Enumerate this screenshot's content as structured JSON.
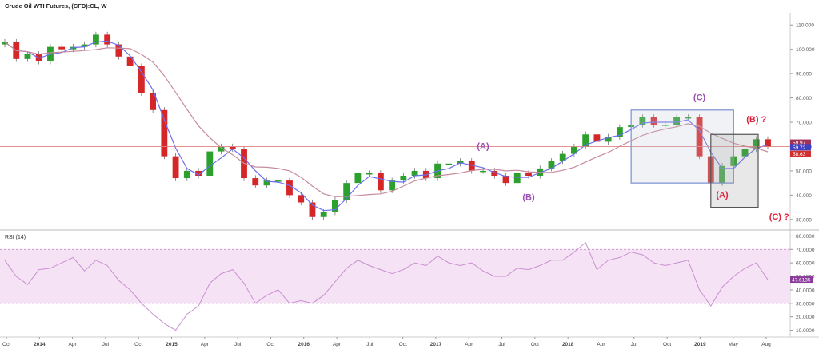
{
  "header": {
    "title": "Crude Oil WTI Futures, (CFD):CL, W"
  },
  "colors": {
    "up": "#2ca02c",
    "down": "#d62728",
    "ma_fast": "#6b6ef0",
    "ma_slow": "#c78b9c",
    "rsi_line": "#c98fd0",
    "rsi_band": "#f5e3f5",
    "price_line": "#e08080",
    "box_blue": "#7a8fd0",
    "box_dark": "#555555",
    "label_purple": "#9b4fb0",
    "label_red": "#e0203a"
  },
  "chart_data": [
    {
      "type": "candlestick",
      "title": "Crude Oil WTI Futures, (CFD):CL, W",
      "x": [
        "2013-10",
        "2013-11",
        "2013-12",
        "2014-01",
        "2014-02",
        "2014-03",
        "2014-04",
        "2014-05",
        "2014-06",
        "2014-07",
        "2014-08",
        "2014-09",
        "2014-10",
        "2014-11",
        "2014-12",
        "2015-01",
        "2015-02",
        "2015-03",
        "2015-04",
        "2015-05",
        "2015-06",
        "2015-07",
        "2015-08",
        "2015-09",
        "2015-10",
        "2015-11",
        "2015-12",
        "2016-01",
        "2016-02",
        "2016-03",
        "2016-04",
        "2016-05",
        "2016-06",
        "2016-07",
        "2016-08",
        "2016-09",
        "2016-10",
        "2016-11",
        "2016-12",
        "2017-01",
        "2017-02",
        "2017-03",
        "2017-04",
        "2017-05",
        "2017-06",
        "2017-07",
        "2017-08",
        "2017-09",
        "2017-10",
        "2017-11",
        "2017-12",
        "2018-01",
        "2018-02",
        "2018-03",
        "2018-04",
        "2018-05",
        "2018-06",
        "2018-07",
        "2018-08",
        "2018-09",
        "2018-10",
        "2018-11",
        "2018-12",
        "2019-01",
        "2019-02",
        "2019-03",
        "2019-04",
        "2019-05"
      ],
      "close": [
        103,
        96,
        98,
        95,
        101,
        100,
        101,
        102,
        106,
        102,
        97,
        93,
        82,
        75,
        56,
        47,
        50,
        48,
        58,
        60,
        59,
        47,
        44,
        46,
        46,
        40,
        37,
        31,
        33,
        38,
        45,
        49,
        49,
        42,
        46,
        48,
        50,
        47,
        53,
        53,
        54,
        50,
        50,
        48,
        45,
        49,
        48,
        51,
        54,
        57,
        60,
        65,
        62,
        64,
        68,
        69,
        72,
        69,
        69,
        72,
        72,
        56,
        45,
        52,
        56,
        59,
        63,
        59.97
      ],
      "ylim": [
        26,
        115
      ],
      "y_ticks": [
        "110.000",
        "100.000",
        "90.000",
        "80.000",
        "70.000",
        "60.000",
        "50.000",
        "40.000",
        "30.000"
      ],
      "x_tick_labels": [
        "Oct",
        "2014",
        "Apr",
        "Jul",
        "Oct",
        "2015",
        "Apr",
        "Jul",
        "Oct",
        "2016",
        "Apr",
        "Jul",
        "Oct",
        "2017",
        "Apr",
        "Jul",
        "Oct",
        "2018",
        "Apr",
        "Jul",
        "Oct",
        "2019",
        "May",
        "Aug"
      ],
      "price_badges": [
        "59.97",
        "59.72",
        "58.63"
      ],
      "annotations": [
        {
          "text": "(A)",
          "color": "purple"
        },
        {
          "text": "(B)",
          "color": "purple"
        },
        {
          "text": "(C)",
          "color": "purple"
        },
        {
          "text": "(A)",
          "color": "red"
        },
        {
          "text": "(B) ?",
          "color": "red"
        },
        {
          "text": "(C) ?",
          "color": "red"
        }
      ]
    },
    {
      "type": "line",
      "title": "RSI (14)",
      "values": [
        62,
        50,
        44,
        55,
        56,
        60,
        64,
        54,
        62,
        58,
        47,
        40,
        30,
        22,
        15,
        10,
        22,
        28,
        45,
        52,
        55,
        45,
        30,
        36,
        40,
        30,
        32,
        30,
        36,
        46,
        56,
        62,
        58,
        55,
        52,
        55,
        60,
        58,
        65,
        60,
        58,
        60,
        54,
        50,
        50,
        56,
        55,
        58,
        62,
        62,
        68,
        75,
        55,
        62,
        64,
        68,
        66,
        60,
        58,
        60,
        62,
        40,
        28,
        42,
        50,
        56,
        60,
        47.61
      ],
      "ylim": [
        5,
        82
      ],
      "y_ticks": [
        "80.0000",
        "70.0000",
        "60.0000",
        "50.0000",
        "40.0000",
        "30.0000",
        "20.0000",
        "10.0000"
      ],
      "band": [
        30,
        70
      ],
      "current_badge": "47.6135"
    }
  ]
}
